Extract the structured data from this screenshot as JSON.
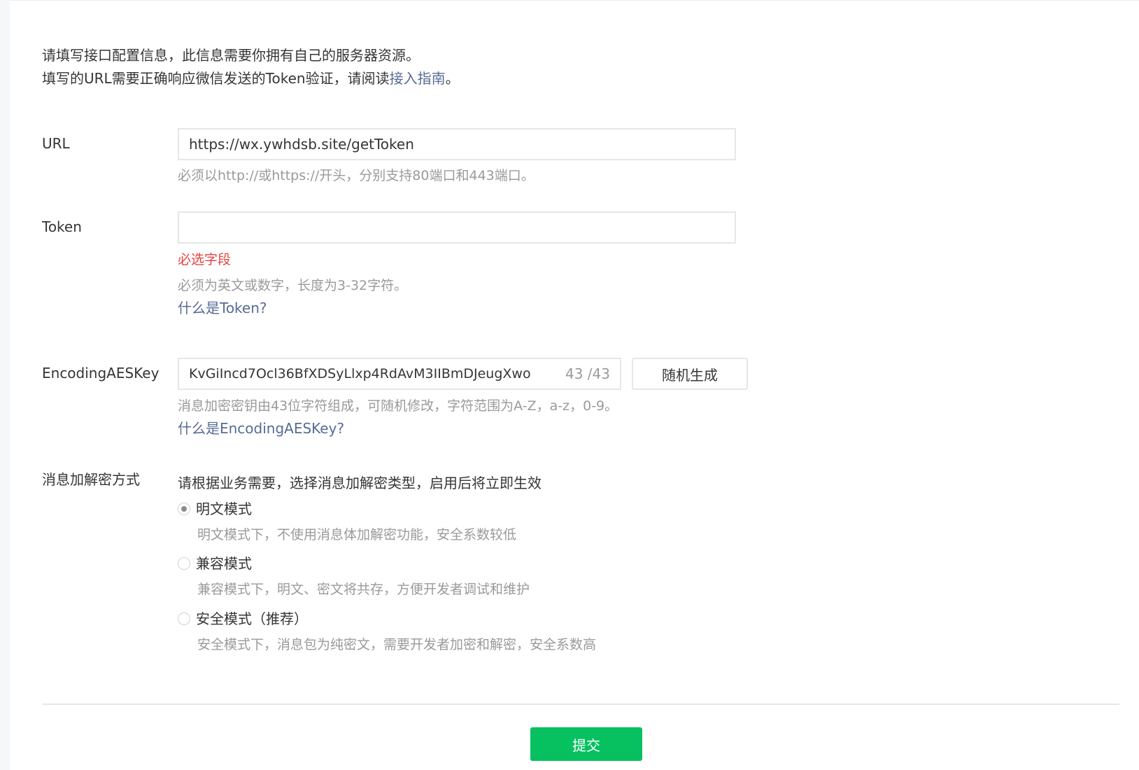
{
  "intro": {
    "line1": "请填写接口配置信息，此信息需要你拥有自己的服务器资源。",
    "line2_prefix": "填写的URL需要正确响应微信发送的Token验证，请阅读",
    "line2_link": "接入指南",
    "line2_suffix": "。"
  },
  "url": {
    "label": "URL",
    "value": "https://wx.ywhdsb.site/getToken",
    "tip": "必须以http://或https://开头，分别支持80端口和443端口。"
  },
  "token": {
    "label": "Token",
    "value": "",
    "error": "必选字段",
    "tip": "必须为英文或数字，长度为3-32字符。",
    "help_link": "什么是Token?"
  },
  "aes": {
    "label": "EncodingAESKey",
    "value": "KvGiIncd7Ocl36BfXDSyLlxp4RdAvM3IIBmDJeugXwo",
    "counter": "43 /43",
    "random_button": "随机生成",
    "tip": "消息加密密钥由43位字符组成，可随机修改，字符范围为A-Z，a-z，0-9。",
    "help_link": "什么是EncodingAESKey?"
  },
  "encryption": {
    "label": "消息加解密方式",
    "description": "请根据业务需要，选择消息加解密类型，启用后将立即生效",
    "options": [
      {
        "label": "明文模式",
        "tip": "明文模式下，不使用消息体加解密功能，安全系数较低",
        "checked": true
      },
      {
        "label": "兼容模式",
        "tip": "兼容模式下，明文、密文将共存，方便开发者调试和维护",
        "checked": false
      },
      {
        "label": "安全模式（推荐）",
        "tip": "安全模式下，消息包为纯密文，需要开发者加密和解密，安全系数高",
        "checked": false
      }
    ]
  },
  "submit_label": "提交",
  "colors": {
    "primary": "#07c160",
    "link": "#576b95",
    "error": "#e64340",
    "tip": "#9a9a9a"
  }
}
